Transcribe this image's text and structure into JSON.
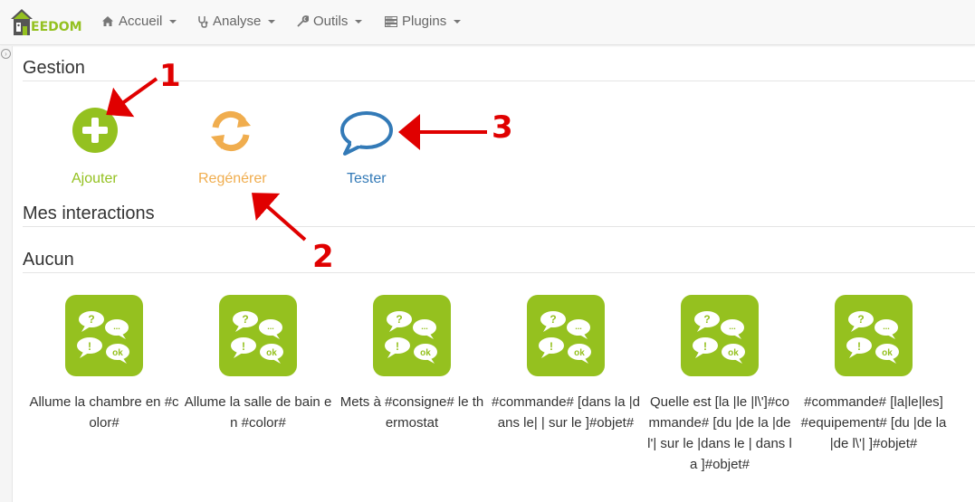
{
  "brand": {
    "name": "EEDOM",
    "color": "#94c120"
  },
  "nav": {
    "items": [
      {
        "label": "Accueil",
        "icon": "home-icon"
      },
      {
        "label": "Analyse",
        "icon": "stethoscope-icon"
      },
      {
        "label": "Outils",
        "icon": "wrench-icon"
      },
      {
        "label": "Plugins",
        "icon": "tasks-icon"
      }
    ]
  },
  "sections": {
    "gestion": "Gestion",
    "mes_interactions": "Mes interactions",
    "aucun": "Aucun"
  },
  "actions": [
    {
      "label": "Ajouter",
      "icon": "plus-circle-icon",
      "color": "#94c120"
    },
    {
      "label": "Regénérer",
      "icon": "refresh-icon",
      "color": "#f0ad4e"
    },
    {
      "label": "Tester",
      "icon": "speech-bubble-icon",
      "color": "#337ab7"
    }
  ],
  "interactions": [
    {
      "label": "Allume la chambre en #color#"
    },
    {
      "label": "Allume la salle de bain en #color#"
    },
    {
      "label": "Mets à #consigne# le thermostat"
    },
    {
      "label": "#commande# [dans la |dans le| | sur le ]#objet#"
    },
    {
      "label": "Quelle est [la |le |l\\']#commande# [du |de la |de l'| sur le |dans le | dans la ]#objet#"
    },
    {
      "label": "#commande# [la|le|les] #equipement# [du |de la |de l\\'| ]#objet#"
    }
  ],
  "annotations": {
    "one": "1",
    "two": "2",
    "three": "3",
    "color": "#e00000"
  },
  "colors": {
    "accent": "#94c120",
    "card_bg": "#95c11f",
    "warning": "#f0ad4e",
    "primary": "#337ab7"
  }
}
